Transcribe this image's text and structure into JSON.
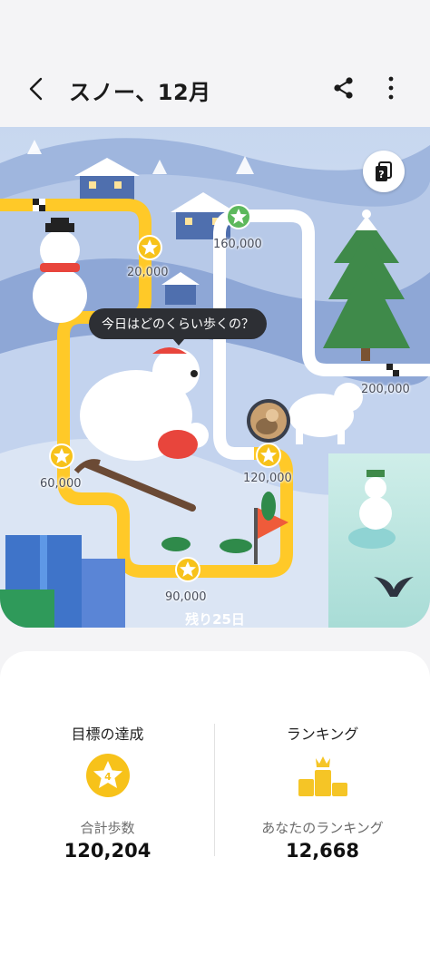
{
  "header": {
    "title": "スノー、12月",
    "back_icon": "chevron-left-icon",
    "share_icon": "share-icon",
    "more_icon": "more-vertical-icon"
  },
  "map": {
    "help_label": "?",
    "speech_text": "今日はどのくらい歩くの？",
    "milestones": [
      "20,000",
      "60,000",
      "90,000",
      "120,000",
      "160,000",
      "200,000"
    ],
    "remaining": "残り25日"
  },
  "stats": {
    "goal": {
      "heading": "目標の達成",
      "badge_count": "4",
      "label": "合計歩数",
      "value": "120,204"
    },
    "ranking": {
      "heading": "ランキング",
      "label": "あなたのランキング",
      "value": "12,668"
    }
  },
  "colors": {
    "path_yellow": "#ffc928",
    "path_white": "#ffffff",
    "star_yellow": "#f7c21a",
    "accent_green": "#5cb85c",
    "ranking_gold": "#f5c526"
  }
}
